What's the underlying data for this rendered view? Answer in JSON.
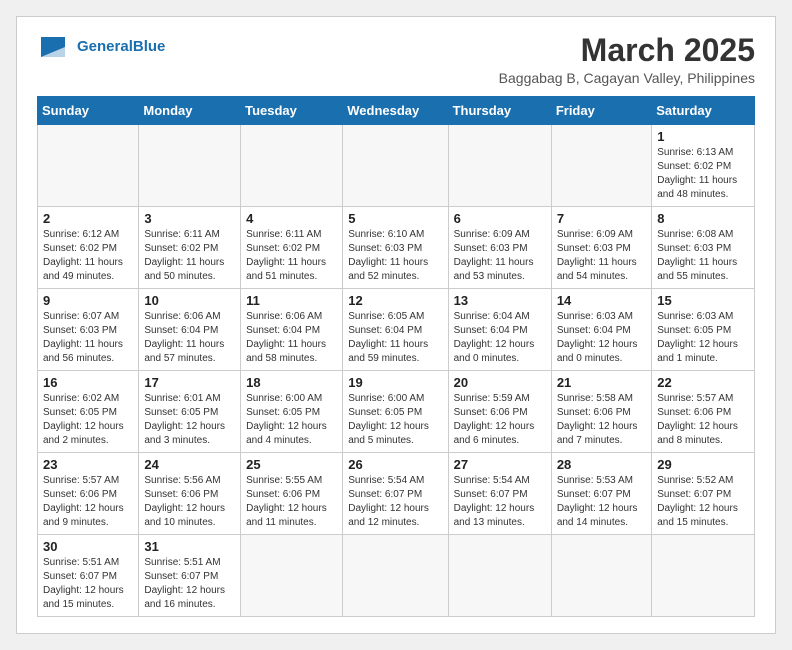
{
  "logo": {
    "text_general": "General",
    "text_blue": "Blue"
  },
  "title": "March 2025",
  "location": "Baggabag B, Cagayan Valley, Philippines",
  "weekdays": [
    "Sunday",
    "Monday",
    "Tuesday",
    "Wednesday",
    "Thursday",
    "Friday",
    "Saturday"
  ],
  "weeks": [
    [
      {
        "day": "",
        "info": ""
      },
      {
        "day": "",
        "info": ""
      },
      {
        "day": "",
        "info": ""
      },
      {
        "day": "",
        "info": ""
      },
      {
        "day": "",
        "info": ""
      },
      {
        "day": "",
        "info": ""
      },
      {
        "day": "1",
        "info": "Sunrise: 6:13 AM\nSunset: 6:02 PM\nDaylight: 11 hours and 48 minutes."
      }
    ],
    [
      {
        "day": "2",
        "info": "Sunrise: 6:12 AM\nSunset: 6:02 PM\nDaylight: 11 hours and 49 minutes."
      },
      {
        "day": "3",
        "info": "Sunrise: 6:11 AM\nSunset: 6:02 PM\nDaylight: 11 hours and 50 minutes."
      },
      {
        "day": "4",
        "info": "Sunrise: 6:11 AM\nSunset: 6:02 PM\nDaylight: 11 hours and 51 minutes."
      },
      {
        "day": "5",
        "info": "Sunrise: 6:10 AM\nSunset: 6:03 PM\nDaylight: 11 hours and 52 minutes."
      },
      {
        "day": "6",
        "info": "Sunrise: 6:09 AM\nSunset: 6:03 PM\nDaylight: 11 hours and 53 minutes."
      },
      {
        "day": "7",
        "info": "Sunrise: 6:09 AM\nSunset: 6:03 PM\nDaylight: 11 hours and 54 minutes."
      },
      {
        "day": "8",
        "info": "Sunrise: 6:08 AM\nSunset: 6:03 PM\nDaylight: 11 hours and 55 minutes."
      }
    ],
    [
      {
        "day": "9",
        "info": "Sunrise: 6:07 AM\nSunset: 6:03 PM\nDaylight: 11 hours and 56 minutes."
      },
      {
        "day": "10",
        "info": "Sunrise: 6:06 AM\nSunset: 6:04 PM\nDaylight: 11 hours and 57 minutes."
      },
      {
        "day": "11",
        "info": "Sunrise: 6:06 AM\nSunset: 6:04 PM\nDaylight: 11 hours and 58 minutes."
      },
      {
        "day": "12",
        "info": "Sunrise: 6:05 AM\nSunset: 6:04 PM\nDaylight: 11 hours and 59 minutes."
      },
      {
        "day": "13",
        "info": "Sunrise: 6:04 AM\nSunset: 6:04 PM\nDaylight: 12 hours and 0 minutes."
      },
      {
        "day": "14",
        "info": "Sunrise: 6:03 AM\nSunset: 6:04 PM\nDaylight: 12 hours and 0 minutes."
      },
      {
        "day": "15",
        "info": "Sunrise: 6:03 AM\nSunset: 6:05 PM\nDaylight: 12 hours and 1 minute."
      }
    ],
    [
      {
        "day": "16",
        "info": "Sunrise: 6:02 AM\nSunset: 6:05 PM\nDaylight: 12 hours and 2 minutes."
      },
      {
        "day": "17",
        "info": "Sunrise: 6:01 AM\nSunset: 6:05 PM\nDaylight: 12 hours and 3 minutes."
      },
      {
        "day": "18",
        "info": "Sunrise: 6:00 AM\nSunset: 6:05 PM\nDaylight: 12 hours and 4 minutes."
      },
      {
        "day": "19",
        "info": "Sunrise: 6:00 AM\nSunset: 6:05 PM\nDaylight: 12 hours and 5 minutes."
      },
      {
        "day": "20",
        "info": "Sunrise: 5:59 AM\nSunset: 6:06 PM\nDaylight: 12 hours and 6 minutes."
      },
      {
        "day": "21",
        "info": "Sunrise: 5:58 AM\nSunset: 6:06 PM\nDaylight: 12 hours and 7 minutes."
      },
      {
        "day": "22",
        "info": "Sunrise: 5:57 AM\nSunset: 6:06 PM\nDaylight: 12 hours and 8 minutes."
      }
    ],
    [
      {
        "day": "23",
        "info": "Sunrise: 5:57 AM\nSunset: 6:06 PM\nDaylight: 12 hours and 9 minutes."
      },
      {
        "day": "24",
        "info": "Sunrise: 5:56 AM\nSunset: 6:06 PM\nDaylight: 12 hours and 10 minutes."
      },
      {
        "day": "25",
        "info": "Sunrise: 5:55 AM\nSunset: 6:06 PM\nDaylight: 12 hours and 11 minutes."
      },
      {
        "day": "26",
        "info": "Sunrise: 5:54 AM\nSunset: 6:07 PM\nDaylight: 12 hours and 12 minutes."
      },
      {
        "day": "27",
        "info": "Sunrise: 5:54 AM\nSunset: 6:07 PM\nDaylight: 12 hours and 13 minutes."
      },
      {
        "day": "28",
        "info": "Sunrise: 5:53 AM\nSunset: 6:07 PM\nDaylight: 12 hours and 14 minutes."
      },
      {
        "day": "29",
        "info": "Sunrise: 5:52 AM\nSunset: 6:07 PM\nDaylight: 12 hours and 15 minutes."
      }
    ],
    [
      {
        "day": "30",
        "info": "Sunrise: 5:51 AM\nSunset: 6:07 PM\nDaylight: 12 hours and 15 minutes."
      },
      {
        "day": "31",
        "info": "Sunrise: 5:51 AM\nSunset: 6:07 PM\nDaylight: 12 hours and 16 minutes."
      },
      {
        "day": "",
        "info": ""
      },
      {
        "day": "",
        "info": ""
      },
      {
        "day": "",
        "info": ""
      },
      {
        "day": "",
        "info": ""
      },
      {
        "day": "",
        "info": ""
      }
    ]
  ]
}
